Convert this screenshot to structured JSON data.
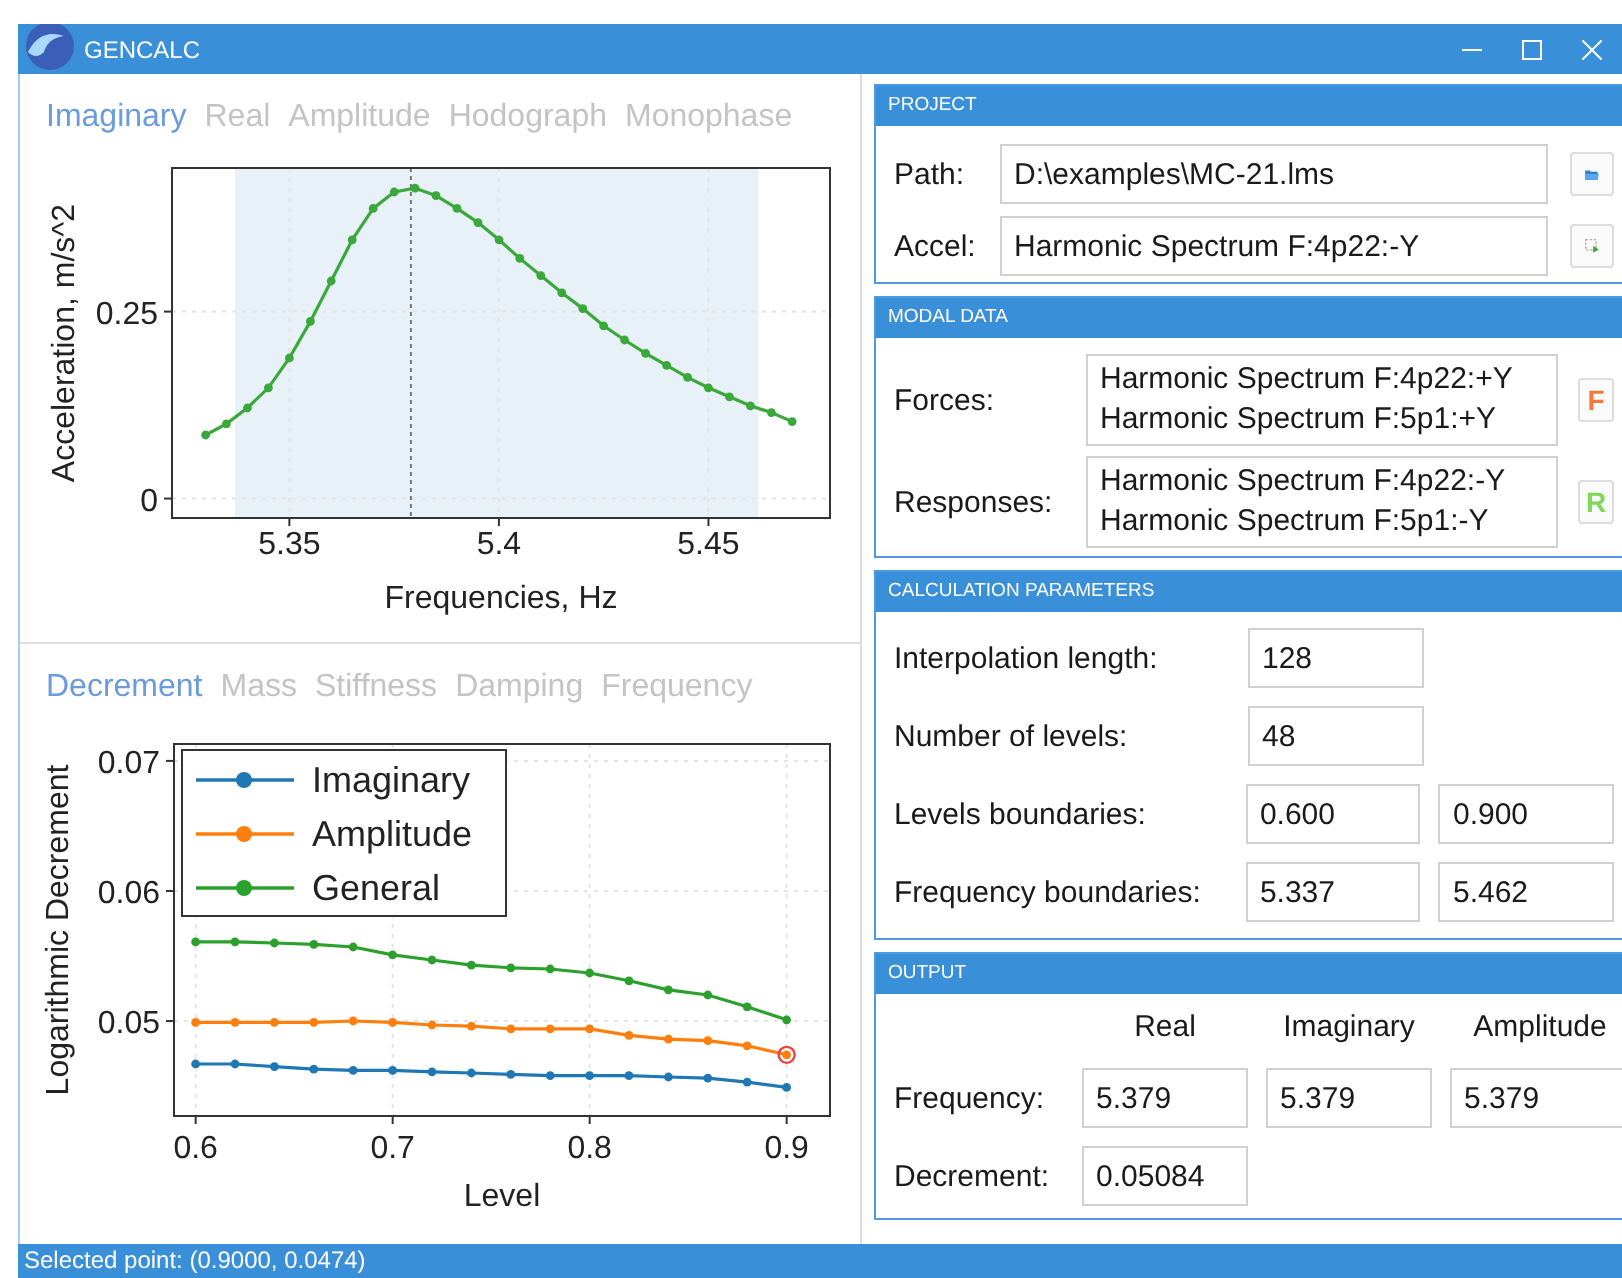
{
  "window": {
    "title": "GENCALC"
  },
  "spectrum_panel": {
    "tabs": [
      {
        "label": "Imaginary",
        "selected": true
      },
      {
        "label": "Real",
        "selected": false
      },
      {
        "label": "Amplitude",
        "selected": false
      },
      {
        "label": "Hodograph",
        "selected": false
      },
      {
        "label": "Monophase",
        "selected": false
      }
    ],
    "chart_data": {
      "type": "line",
      "xlabel": "Frequencies, Hz",
      "ylabel": "Acceleration, m/s^2",
      "x": [
        5.33,
        5.335,
        5.34,
        5.345,
        5.35,
        5.355,
        5.36,
        5.365,
        5.37,
        5.375,
        5.38,
        5.385,
        5.39,
        5.395,
        5.4,
        5.405,
        5.41,
        5.415,
        5.42,
        5.425,
        5.43,
        5.435,
        5.44,
        5.445,
        5.45,
        5.455,
        5.46,
        5.465,
        5.47
      ],
      "values": [
        0.085,
        0.1,
        0.121,
        0.148,
        0.188,
        0.237,
        0.291,
        0.346,
        0.388,
        0.41,
        0.415,
        0.405,
        0.388,
        0.369,
        0.346,
        0.321,
        0.298,
        0.275,
        0.254,
        0.231,
        0.212,
        0.194,
        0.178,
        0.162,
        0.148,
        0.136,
        0.124,
        0.115,
        0.103
      ],
      "xlim": [
        5.322,
        5.479
      ],
      "ylim": [
        -0.026,
        0.442
      ],
      "xticks": [
        5.35,
        5.4,
        5.45
      ],
      "yticks": [
        0,
        0.25
      ],
      "grid": true,
      "bands": [
        {
          "axis": "x",
          "from": 5.337,
          "to": 5.462
        }
      ],
      "ref_lines": [
        {
          "axis": "x",
          "value": 5.379
        }
      ]
    }
  },
  "decrement_panel": {
    "tabs": [
      {
        "label": "Decrement",
        "selected": true
      },
      {
        "label": "Mass",
        "selected": false
      },
      {
        "label": "Stiffness",
        "selected": false
      },
      {
        "label": "Damping",
        "selected": false
      },
      {
        "label": "Frequency",
        "selected": false
      }
    ],
    "chart_data": {
      "type": "line",
      "xlabel": "Level",
      "ylabel": "Logarithmic Decrement",
      "x": [
        0.6,
        0.62,
        0.64,
        0.66,
        0.68,
        0.7,
        0.72,
        0.74,
        0.76,
        0.78,
        0.8,
        0.82,
        0.84,
        0.86,
        0.88,
        0.9
      ],
      "series": [
        {
          "name": "Imaginary",
          "color": "#1f77b4",
          "values": [
            0.0467,
            0.0467,
            0.0465,
            0.0463,
            0.0462,
            0.0462,
            0.0461,
            0.046,
            0.0459,
            0.0458,
            0.0458,
            0.0458,
            0.0457,
            0.0456,
            0.0453,
            0.0449
          ]
        },
        {
          "name": "Amplitude",
          "color": "#ff7f0e",
          "values": [
            0.0499,
            0.0499,
            0.0499,
            0.0499,
            0.05,
            0.0499,
            0.0497,
            0.0496,
            0.0494,
            0.0494,
            0.0494,
            0.0489,
            0.0486,
            0.0485,
            0.0481,
            0.0474
          ]
        },
        {
          "name": "General",
          "color": "#2ca02c",
          "values": [
            0.0561,
            0.0561,
            0.056,
            0.0559,
            0.0557,
            0.0551,
            0.0547,
            0.0543,
            0.0541,
            0.054,
            0.0537,
            0.0531,
            0.0524,
            0.052,
            0.0511,
            0.0501
          ]
        }
      ],
      "xlim": [
        0.589,
        0.922
      ],
      "ylim": [
        0.0427,
        0.0713
      ],
      "xticks": [
        0.6,
        0.7,
        0.8,
        0.9
      ],
      "yticks": [
        0.05,
        0.06,
        0.07
      ],
      "grid": true,
      "legend": "upper left"
    },
    "series_states": [
      {
        "selected": false
      },
      {
        "selected": true
      },
      {
        "selected": false
      }
    ]
  },
  "project": {
    "title": "PROJECT",
    "fields": [
      {
        "label": "Path:",
        "value": "D:\\examples\\MC-21.lms",
        "kind": "open"
      },
      {
        "label": "Accel:",
        "value": "Harmonic Spectrum F:4p22:-Y",
        "kind": "select"
      }
    ]
  },
  "modal_data": {
    "title": "MODAL DATA",
    "lists": [
      {
        "label": "Forces:",
        "items": [
          "Harmonic Spectrum F:4p22:+Y",
          "Harmonic Spectrum F:5p1:+Y"
        ],
        "button": "F",
        "color": "#f5793a"
      },
      {
        "label": "Responses:",
        "items": [
          "Harmonic Spectrum F:4p22:-Y",
          "Harmonic Spectrum F:5p1:-Y"
        ],
        "button": "R",
        "color": "#7ed957"
      }
    ]
  },
  "calculation_parameters": {
    "title": "CALCULATION PARAMETERS",
    "rows": [
      {
        "label": "Interpolation length:",
        "values": [
          "128"
        ]
      },
      {
        "label": "Number of levels:",
        "values": [
          "48"
        ]
      },
      {
        "label": "Levels boundaries:",
        "values": [
          "0.600",
          "0.900"
        ]
      },
      {
        "label": "Frequency boundaries:",
        "values": [
          "5.337",
          "5.462"
        ]
      }
    ]
  },
  "output": {
    "title": "OUTPUT",
    "columns": [
      "Real",
      "Imaginary",
      "Amplitude"
    ],
    "rows": [
      {
        "label": "Frequency:",
        "values": [
          "5.379",
          "5.379",
          "5.379"
        ]
      },
      {
        "label": "Decrement:",
        "values": [
          "0.05084"
        ]
      }
    ]
  },
  "status_bar": "Selected point: (0.9000, 0.0474)"
}
